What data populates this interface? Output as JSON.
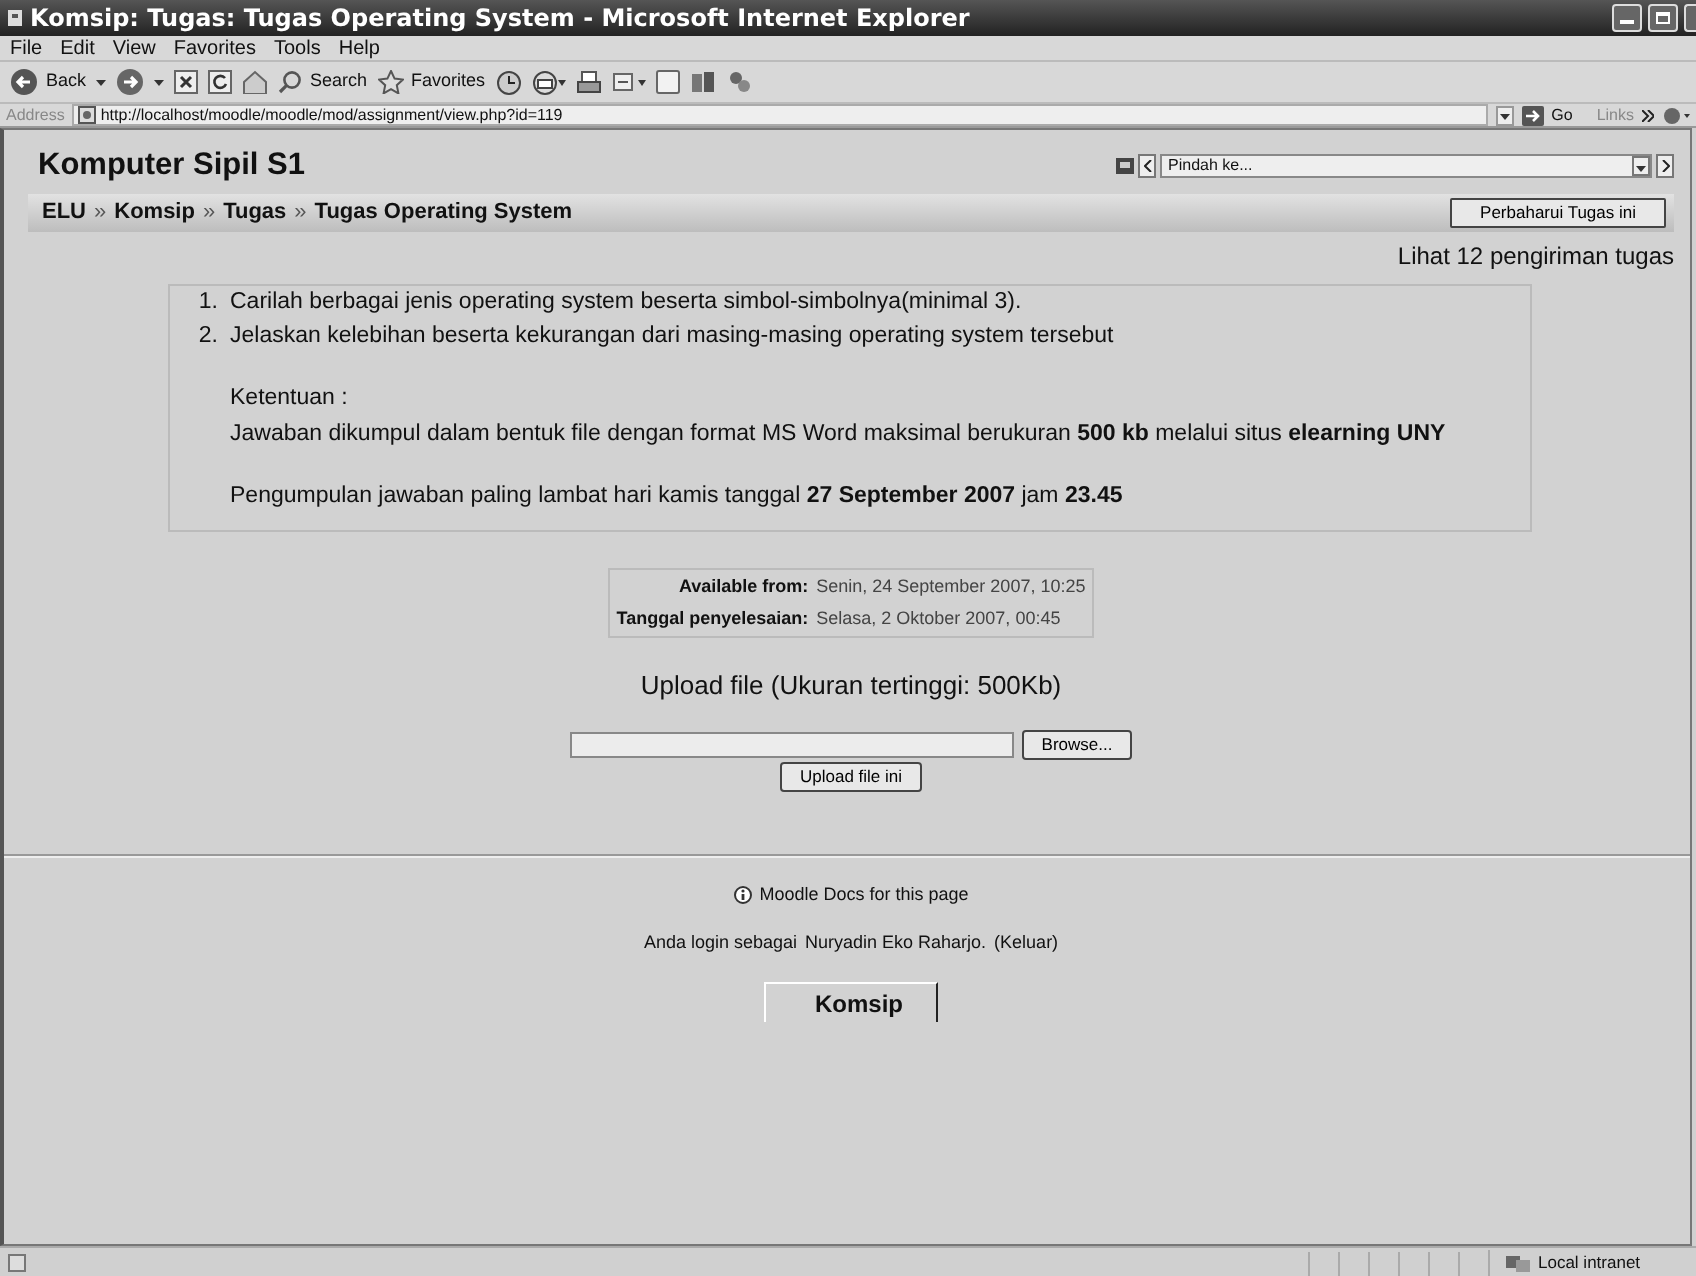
{
  "window": {
    "title": "Komsip: Tugas: Tugas Operating System - Microsoft Internet Explorer"
  },
  "menu": [
    "File",
    "Edit",
    "View",
    "Favorites",
    "Tools",
    "Help"
  ],
  "toolbar": {
    "back": "Back",
    "search": "Search",
    "favorites": "Favorites"
  },
  "address": {
    "label": "Address",
    "url": "http://localhost/moodle/moodle/mod/assignment/view.php?id=119",
    "go": "Go",
    "links": "Links"
  },
  "page": {
    "course_title": "Komputer Sipil S1",
    "jump": {
      "placeholder": "Pindah ke..."
    },
    "breadcrumb": [
      "ELU",
      "Komsip",
      "Tugas",
      "Tugas Operating System"
    ],
    "breadcrumb_separator": "»",
    "update_button": "Perbaharui Tugas ini",
    "submissions_link": "Lihat 12 pengiriman tugas",
    "tasks": [
      {
        "number": "1.",
        "text": "Carilah berbagai jenis operating system beserta simbol-simbolnya(minimal 3)."
      },
      {
        "number": "2.",
        "text": "Jelaskan kelebihan beserta kekurangan dari masing-masing operating system tersebut"
      }
    ],
    "notes": [
      "Ketentuan :",
      "Jawaban dikumpul dalam bentuk file dengan format MS Word maksimal berukuran **500 kb** melalui situs **elearning UNY**",
      "Pengumpulan jawaban paling lambat hari kamis tanggal **27 September 2007** jam **23.45**"
    ],
    "dates": [
      {
        "label": "Available from:",
        "value": "Senin, 24 September 2007, 10:25"
      },
      {
        "label": "Tanggal penyelesaian:",
        "value": "Selasa, 2 Oktober 2007, 00:45"
      }
    ],
    "upload": {
      "title": "Upload file (Ukuran tertinggi: 500Kb)",
      "browse": "Browse...",
      "submit": "Upload file ini"
    },
    "docs_link": "Moodle Docs for this page",
    "login": {
      "prefix": "Anda login sebagai",
      "user": "Nuryadin Eko Raharjo.",
      "logout": "(Keluar)"
    },
    "home_link": "Komsip"
  },
  "status_bar": {
    "zone": "Local intranet"
  }
}
